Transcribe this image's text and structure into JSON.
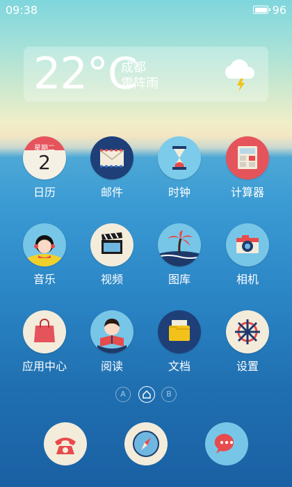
{
  "status": {
    "time": "09:38",
    "battery": "96"
  },
  "weather": {
    "temperature": "22°C",
    "city": "成都",
    "condition": "雷阵雨",
    "icon": "thunderstorm-cloud-icon"
  },
  "calendar_icon": {
    "weekday": "星期二",
    "day": "2"
  },
  "apps": [
    {
      "label": "日历",
      "icon": "calendar-icon"
    },
    {
      "label": "邮件",
      "icon": "mail-icon"
    },
    {
      "label": "时钟",
      "icon": "hourglass-icon"
    },
    {
      "label": "计算器",
      "icon": "calculator-icon"
    },
    {
      "label": "音乐",
      "icon": "music-girl-icon"
    },
    {
      "label": "视频",
      "icon": "clapperboard-icon"
    },
    {
      "label": "图库",
      "icon": "palm-island-icon"
    },
    {
      "label": "相机",
      "icon": "camera-icon"
    },
    {
      "label": "应用中心",
      "icon": "shopping-bag-icon"
    },
    {
      "label": "阅读",
      "icon": "reader-boy-icon"
    },
    {
      "label": "文档",
      "icon": "folder-icon"
    },
    {
      "label": "设置",
      "icon": "ship-wheel-icon"
    }
  ],
  "page_indicator": {
    "left": "A",
    "right": "B",
    "active": "home"
  },
  "dock": [
    {
      "icon": "telephone-icon"
    },
    {
      "icon": "compass-icon"
    },
    {
      "icon": "message-bubble-icon"
    }
  ],
  "colors": {
    "accent_red": "#e74b4b",
    "navy": "#1e3a6b",
    "cream": "#f3ecdb"
  }
}
